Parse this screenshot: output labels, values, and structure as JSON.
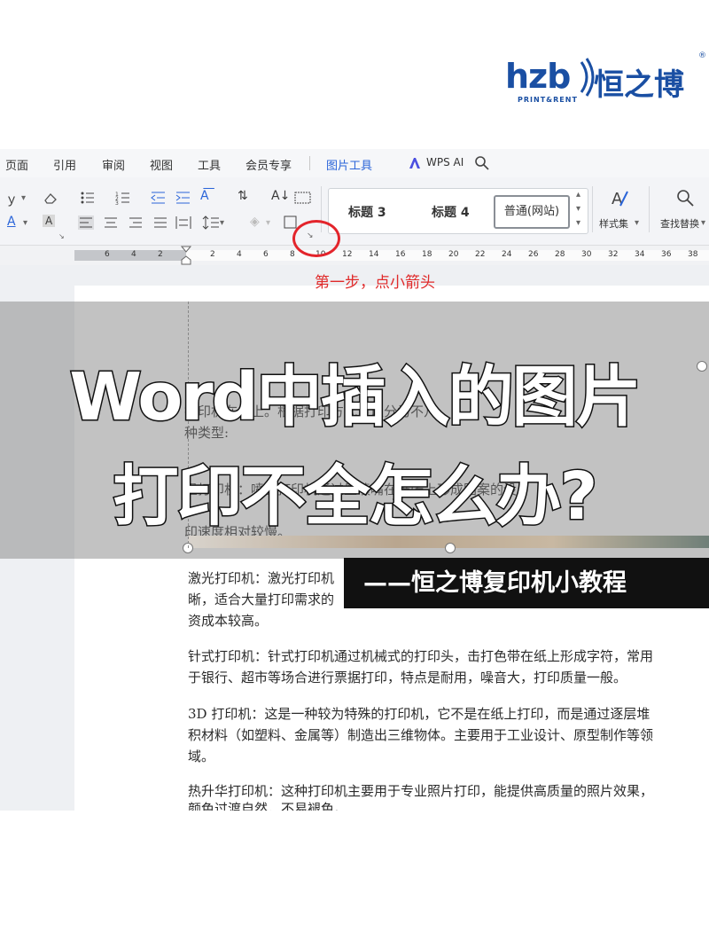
{
  "logo": {
    "brand": "hzb",
    "tagline": "PRINT&RENT",
    "cn_name": "恒之博",
    "registered": "®"
  },
  "menu": {
    "tabs": [
      "页面",
      "引用",
      "审阅",
      "视图",
      "工具",
      "会员专享",
      "图片工具",
      "WPS AI"
    ],
    "active": "图片工具"
  },
  "toolbar": {
    "styles": [
      "标题 3",
      "标题 4",
      "普通(网站)"
    ],
    "styles_label": "样式集",
    "find_replace_label": "查找替换"
  },
  "ruler": {
    "ticks": [
      "6",
      "4",
      "2",
      "2",
      "4",
      "6",
      "8",
      "10",
      "12",
      "14",
      "16",
      "18",
      "20",
      "22",
      "24",
      "26",
      "28",
      "30",
      "32",
      "34",
      "36",
      "38"
    ]
  },
  "annotation": {
    "step": "第一步，点小箭头"
  },
  "overlay": {
    "title_line1": "Word中插入的图片",
    "title_line2": "打印不全怎么办?",
    "subtitle": "——恒之博复印机小教程"
  },
  "document": {
    "band_lines": [
      "打印机在纸上。根据打印方式可以分为不几",
      "种类型:",
      "墨打印机：喷墨打印机通过墨喷嘴在纸张上形成图案的设",
      "印速度相对较慢。"
    ],
    "paragraphs": [
      [
        "激光打印机：激光打印机",
        "晰，适合大量打印需求的",
        "资成本较高。"
      ],
      [
        "针式打印机：针式打印机通过机械式的打印头，击打色带在纸上形成字符，常用",
        "于银行、超市等场合进行票据打印，特点是耐用，噪音大，打印质量一般。"
      ],
      [
        "3D 打印机：这是一种较为特殊的打印机，它不是在纸上打印，而是通过逐层堆",
        "积材料（如塑料、金属等）制造出三维物体。主要用于工业设计、原型制作等领",
        "域。"
      ],
      [
        "热升华打印机：这种打印机主要用于专业照片打印，能提供高质量的照片效果，",
        "颜色过渡自然，不易褪色。"
      ]
    ]
  },
  "colors": {
    "brand_blue": "#1a4fa3",
    "accent_blue": "#2b65d9",
    "annotation_red": "#e3242b"
  },
  "icons": [
    "search-icon",
    "wps-ai-icon",
    "eraser-icon",
    "font-color-icon",
    "char-shading-icon",
    "bullets-icon",
    "numbering-icon",
    "indent-decrease-icon",
    "indent-increase-icon",
    "align-left-icon",
    "align-center-icon",
    "align-right-icon",
    "justify-icon",
    "distribute-icon",
    "line-spacing-icon",
    "borders-icon",
    "dialog-launcher-icon",
    "style-pen-icon",
    "find-icon",
    "sort-icon",
    "show-marks-icon"
  ]
}
